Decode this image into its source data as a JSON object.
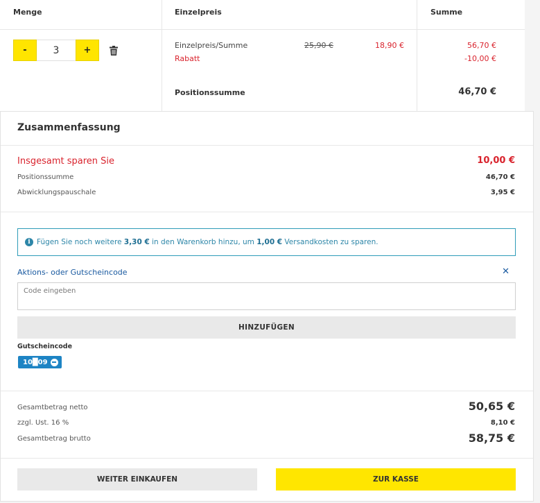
{
  "cart": {
    "headers": {
      "qty": "Menge",
      "unit_price": "Einzelpreis",
      "total": "Summe"
    },
    "item": {
      "qty_minus": "-",
      "qty_value": "3",
      "qty_plus": "+",
      "price_label": "Einzelpreis/Summe",
      "discount_label": "Rabatt",
      "old_price": "25,90 €",
      "new_price": "18,90 €",
      "line_total": "56,70 €",
      "discount_value": "-10,00 €",
      "position_label": "Positionssumme",
      "position_total": "46,70 €"
    }
  },
  "summary": {
    "title": "Zusammenfassung",
    "savings_label": "Insgesamt sparen Sie",
    "savings_value": "10,00 €",
    "position_label": "Positionssumme",
    "position_value": "46,70 €",
    "fee_label": "Abwicklungspauschale",
    "fee_value": "3,95 €",
    "info": {
      "pre": "Fügen Sie noch weitere ",
      "amount": "3,30 €",
      "mid": " in den Warenkorb hinzu, um ",
      "save": "1,00 €",
      "post": " Versandkosten zu sparen."
    },
    "coupon_label": "Aktions- oder Gutscheincode",
    "code_placeholder": "Code eingeben",
    "add_button": "HINZUFÜGEN",
    "voucher_label": "Gutscheincode",
    "voucher_code": "10█09",
    "net_label": "Gesamtbetrag netto",
    "net_value": "50,65 €",
    "vat_label": "zzgl. Ust. 16 %",
    "vat_value": "8,10 €",
    "gross_label": "Gesamtbetrag brutto",
    "gross_value": "58,75 €",
    "continue_button": "WEITER EINKAUFEN",
    "checkout_button": "ZUR KASSE"
  },
  "colors": {
    "accent_yellow": "#ffe500",
    "price_red": "#d9232d",
    "info_blue": "#2d86a8",
    "link_blue": "#1a5aa0"
  },
  "icons": {
    "trash": "trash-icon",
    "info": "info-icon",
    "close": "close-icon",
    "remove": "minus-circle-icon"
  }
}
